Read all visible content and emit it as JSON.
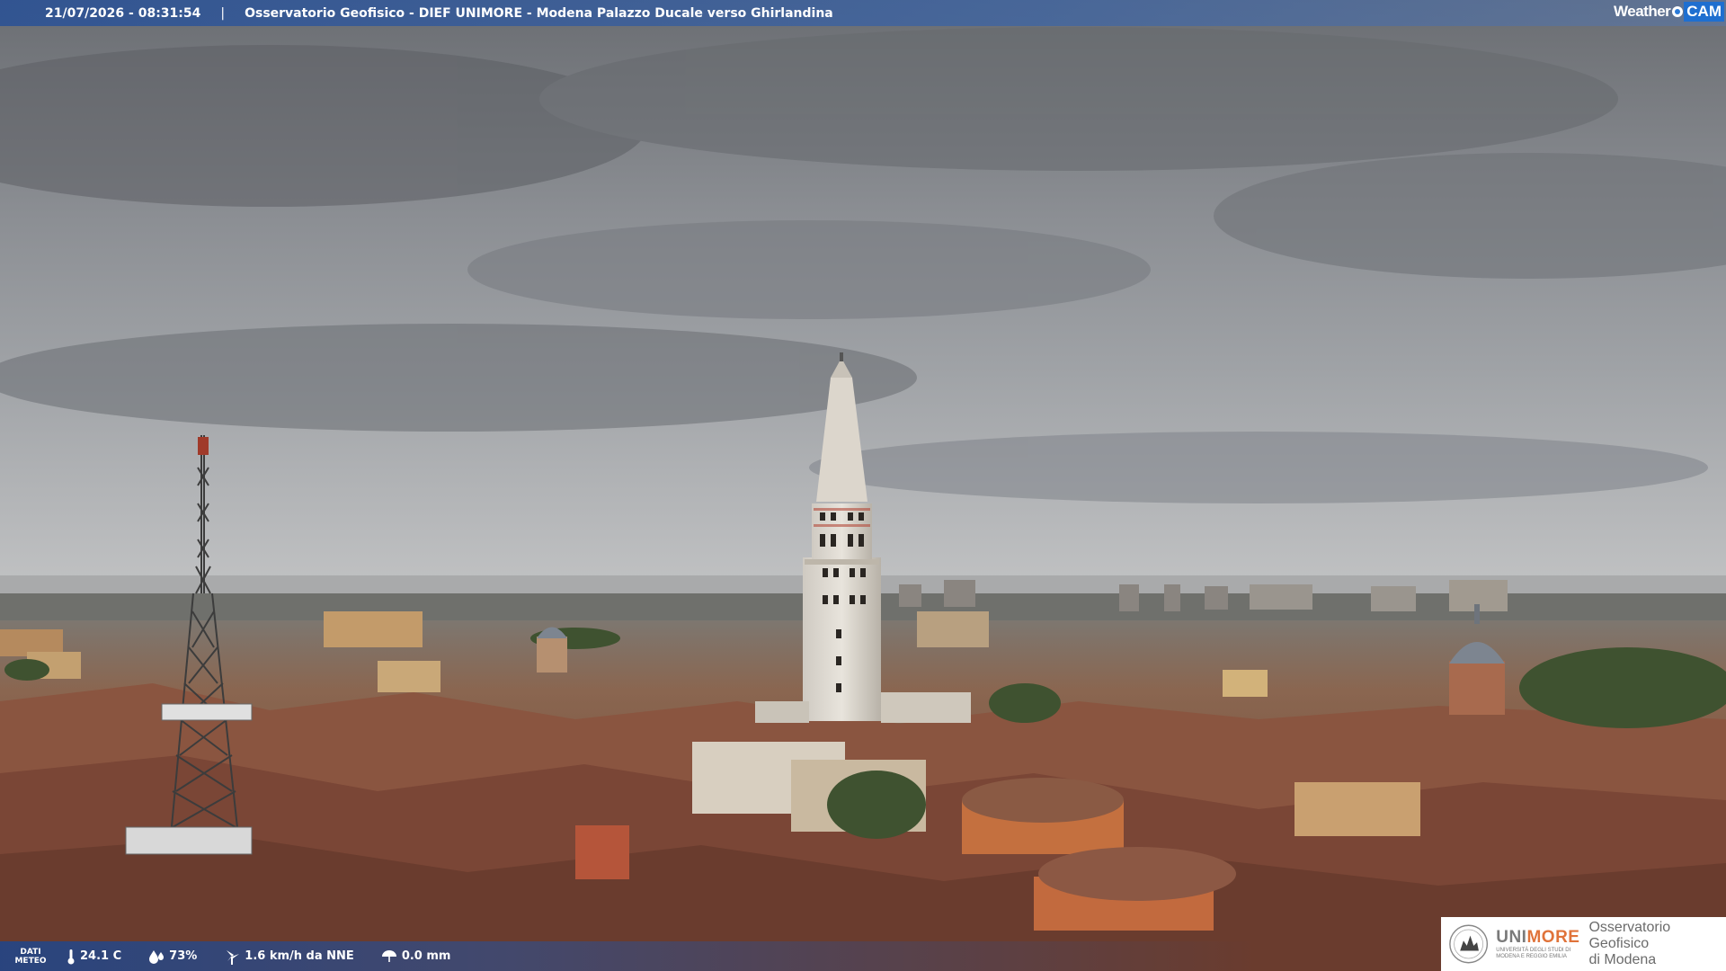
{
  "header": {
    "datetime": "21/07/2026 - 08:31:54",
    "separator": "|",
    "location": "Osservatorio Geofisico - DIEF UNIMORE - Modena Palazzo Ducale verso Ghirlandina"
  },
  "logo": {
    "weather": "Weather",
    "cam": "CAM"
  },
  "meteo": {
    "label_line1": "DATI",
    "label_line2": "METEO",
    "temperature": "24.1 C",
    "humidity": "73%",
    "wind": "1.6 km/h da NNE",
    "rain": "0.0 mm"
  },
  "institution": {
    "brand_a": "UNI",
    "brand_b": "MORE",
    "sub_line1": "UNIVERSITÀ DEGLI STUDI DI",
    "sub_line2": "MODENA E REGGIO EMILIA",
    "name_line1": "Osservatorio Geofisico",
    "name_line2": "di Modena"
  },
  "colors": {
    "accent": "#e0733a",
    "bar": "#3a64a8",
    "sky": "#8a8d91",
    "roof": "#8a5a44"
  }
}
